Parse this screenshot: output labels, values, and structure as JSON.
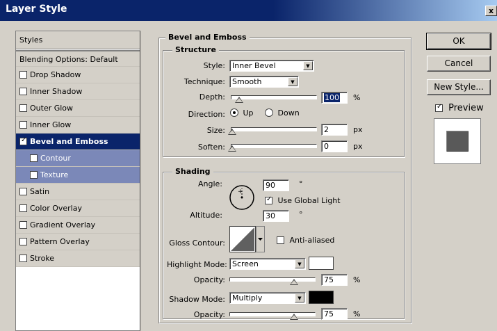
{
  "window": {
    "title": "Layer Style",
    "close_glyph": "x"
  },
  "styles_panel": {
    "header": "Styles",
    "items": [
      {
        "label": "Blending Options: Default",
        "checkbox": false,
        "checked": false
      },
      {
        "label": "Drop Shadow",
        "checkbox": true,
        "checked": false
      },
      {
        "label": "Inner Shadow",
        "checkbox": true,
        "checked": false
      },
      {
        "label": "Outer Glow",
        "checkbox": true,
        "checked": false
      },
      {
        "label": "Inner Glow",
        "checkbox": true,
        "checked": false
      },
      {
        "label": "Bevel and Emboss",
        "checkbox": true,
        "checked": true,
        "selected": true
      },
      {
        "label": "Contour",
        "checkbox": true,
        "checked": false,
        "sub": true
      },
      {
        "label": "Texture",
        "checkbox": true,
        "checked": false,
        "sub": true
      },
      {
        "label": "Satin",
        "checkbox": true,
        "checked": false
      },
      {
        "label": "Color Overlay",
        "checkbox": true,
        "checked": false
      },
      {
        "label": "Gradient Overlay",
        "checkbox": true,
        "checked": false
      },
      {
        "label": "Pattern Overlay",
        "checkbox": true,
        "checked": false
      },
      {
        "label": "Stroke",
        "checkbox": true,
        "checked": false
      }
    ]
  },
  "bevel": {
    "title": "Bevel and Emboss",
    "structure": {
      "title": "Structure",
      "style_label": "Style:",
      "style_value": "Inner Bevel",
      "technique_label": "Technique:",
      "technique_value": "Smooth",
      "depth_label": "Depth:",
      "depth_value": "100",
      "depth_unit": "%",
      "direction_label": "Direction:",
      "direction_up": "Up",
      "direction_down": "Down",
      "size_label": "Size:",
      "size_value": "2",
      "size_unit": "px",
      "soften_label": "Soften:",
      "soften_value": "0",
      "soften_unit": "px"
    },
    "shading": {
      "title": "Shading",
      "angle_label": "Angle:",
      "angle_value": "90",
      "angle_unit": "°",
      "global_light_label": "Use Global Light",
      "global_light_checked": true,
      "altitude_label": "Altitude:",
      "altitude_value": "30",
      "altitude_unit": "°",
      "gloss_label": "Gloss Contour:",
      "anti_aliased_label": "Anti-aliased",
      "highlight_label": "Highlight Mode:",
      "highlight_value": "Screen",
      "highlight_color": "#ffffff",
      "highlight_opacity_label": "Opacity:",
      "highlight_opacity_value": "75",
      "highlight_opacity_unit": "%",
      "shadow_label": "Shadow Mode:",
      "shadow_value": "Multiply",
      "shadow_color": "#000000",
      "shadow_opacity_label": "Opacity:",
      "shadow_opacity_value": "75",
      "shadow_opacity_unit": "%"
    }
  },
  "buttons": {
    "ok": "OK",
    "cancel": "Cancel",
    "new_style": "New Style...",
    "preview": "Preview",
    "preview_checked": true
  },
  "colors": {
    "title_bar": "#0a246a",
    "selected_row": "#0a246a",
    "sub_row": "#7b88b8",
    "preview_swatch": "#595959"
  }
}
